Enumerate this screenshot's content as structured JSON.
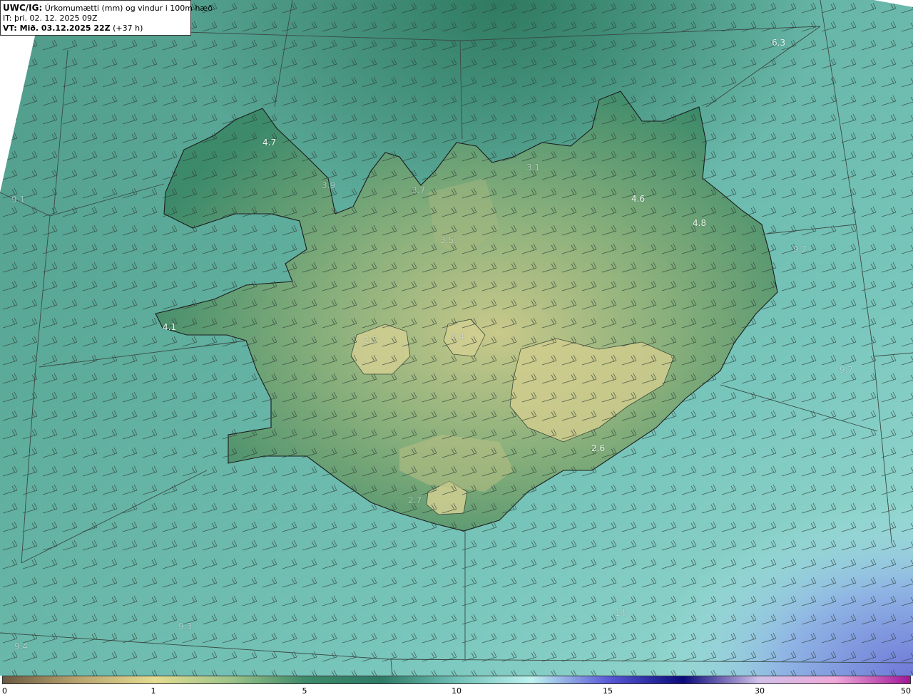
{
  "header": {
    "code": "UWC/IG:",
    "title": "Úrkomumætti (mm) og vindur i 100m hæð",
    "it_line": "IT: þri. 02. 12. 2025 09Z",
    "vt_prefix": "VT: Mið. 03.12.2025 22Z",
    "vt_suffix": "(+37 h)"
  },
  "map_labels": [
    {
      "text": "4.7",
      "style": "bright"
    },
    {
      "text": "6.3",
      "style": "bright"
    },
    {
      "text": "3.9",
      "style": "faint"
    },
    {
      "text": "3.7",
      "style": "faint"
    },
    {
      "text": "3.1",
      "style": "faint"
    },
    {
      "text": "4.6",
      "style": "bright"
    },
    {
      "text": "4.8",
      "style": "bright"
    },
    {
      "text": "3.5",
      "style": "faint"
    },
    {
      "text": "4.1",
      "style": "bright"
    },
    {
      "text": "2.5",
      "style": "faint"
    },
    {
      "text": "2.4",
      "style": "faint"
    },
    {
      "text": "2.6",
      "style": "bright"
    },
    {
      "text": "2.7",
      "style": "faint"
    },
    {
      "text": "9.1",
      "style": "faint"
    },
    {
      "text": "9.2",
      "style": "faint"
    },
    {
      "text": "9.7",
      "style": "faint"
    },
    {
      "text": "9.3",
      "style": "faint"
    },
    {
      "text": "9.4",
      "style": "faint"
    },
    {
      "text": "14",
      "style": "faint"
    }
  ],
  "colorbar": {
    "ticks": [
      "0",
      "1",
      "5",
      "10",
      "15",
      "30",
      "50"
    ],
    "colors": [
      "#6b5a42",
      "#b8a46e",
      "#e4dc92",
      "#9ec48a",
      "#3e8a6a",
      "#2f7a66",
      "#6fc0b6",
      "#bff2ef",
      "#5a5ad8",
      "#0a0a7a",
      "#d0c0e8",
      "#f0a8d8",
      "#a01898"
    ]
  },
  "colors": {
    "land_high": "#c9c98a",
    "land_low": "#3c8a6a",
    "sea": "#6ab8aa",
    "coast": "#1c1c1c"
  }
}
